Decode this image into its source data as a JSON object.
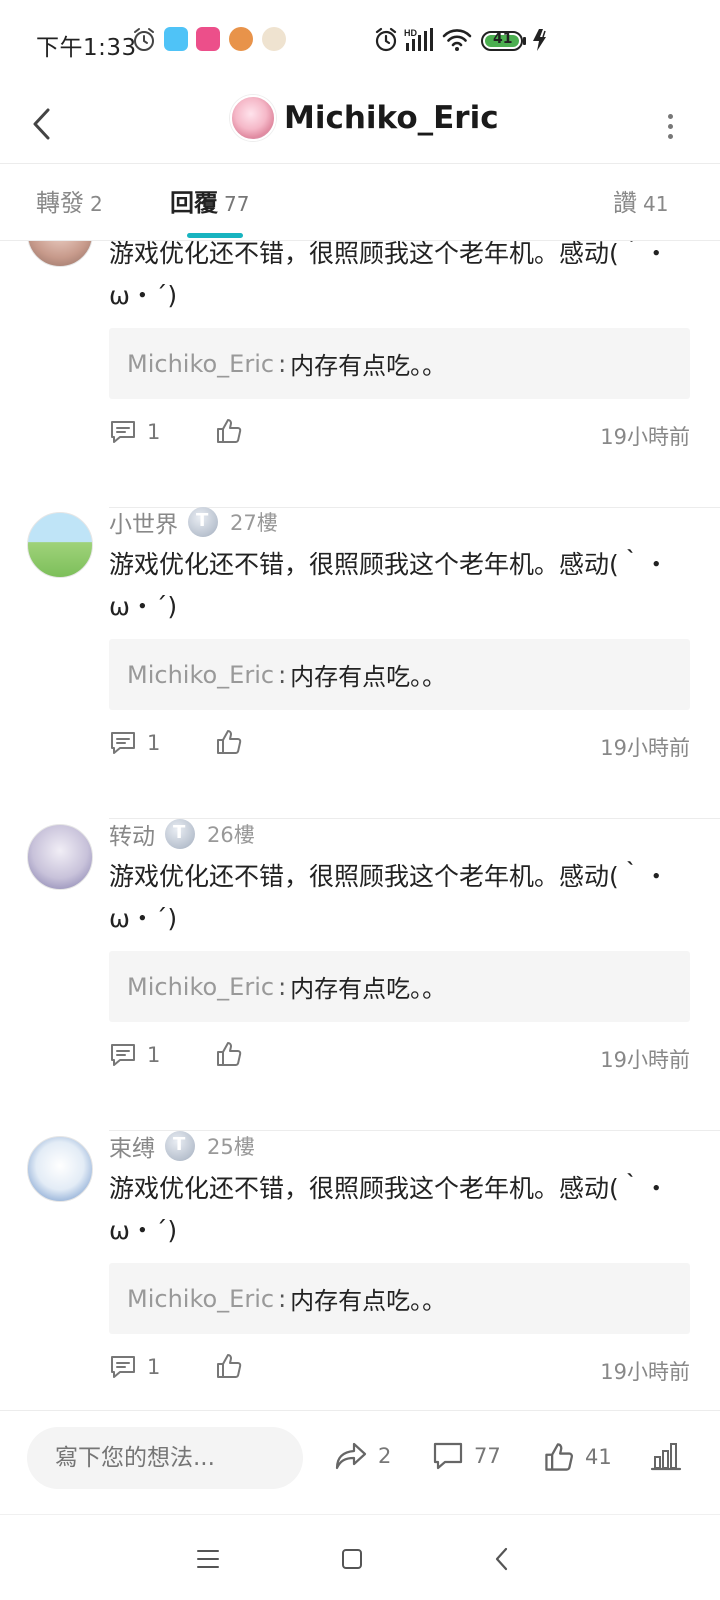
{
  "status_bar": {
    "time": "下午1:33",
    "battery": "41",
    "icons": [
      "alarm-icon",
      "app-notification-icons",
      "hd-signal-icon",
      "wifi-icon",
      "battery-icon",
      "charging-icon"
    ]
  },
  "header": {
    "title": "Michiko_Eric",
    "back_icon": "chevron-left-icon",
    "more_icon": "more-vertical-icon"
  },
  "tabs": [
    {
      "label": "轉發",
      "count": "2",
      "active": false
    },
    {
      "label": "回覆",
      "count": "77",
      "active": true
    },
    {
      "label": "讚",
      "count": "41",
      "active": false
    }
  ],
  "posts": [
    {
      "username": "",
      "floor": "",
      "text": "游戏优化还不错，很照顾我这个老年机。感动(｀・ω・´)",
      "quote_author": "Michiko_Eric",
      "quote_sep": ":",
      "quote_text": "内存有点吃。。",
      "reply_count": "1",
      "time": "19小時前"
    },
    {
      "username": "小世界",
      "floor": "27樓",
      "text": "游戏优化还不错，很照顾我这个老年机。感动(｀・ω・´)",
      "quote_author": "Michiko_Eric",
      "quote_sep": ":",
      "quote_text": "内存有点吃。。",
      "reply_count": "1",
      "time": "19小時前"
    },
    {
      "username": "转动",
      "floor": "26樓",
      "text": "游戏优化还不错，很照顾我这个老年机。感动(｀・ω・´)",
      "quote_author": "Michiko_Eric",
      "quote_sep": ":",
      "quote_text": "内存有点吃。。",
      "reply_count": "1",
      "time": "19小時前"
    },
    {
      "username": "束缚",
      "floor": "25樓",
      "text": "游戏优化还不错，很照顾我这个老年机。感动(｀・ω・´)",
      "quote_author": "Michiko_Eric",
      "quote_sep": ":",
      "quote_text": "内存有点吃。。",
      "reply_count": "1",
      "time": "19小時前"
    }
  ],
  "bottom_bar": {
    "input_placeholder": "寫下您的想法...",
    "share_count": "2",
    "comment_count": "77",
    "like_count": "41"
  },
  "colors": {
    "accent": "#18b4c0",
    "quote_bg": "#f5f5f5",
    "muted_text": "#888888"
  }
}
